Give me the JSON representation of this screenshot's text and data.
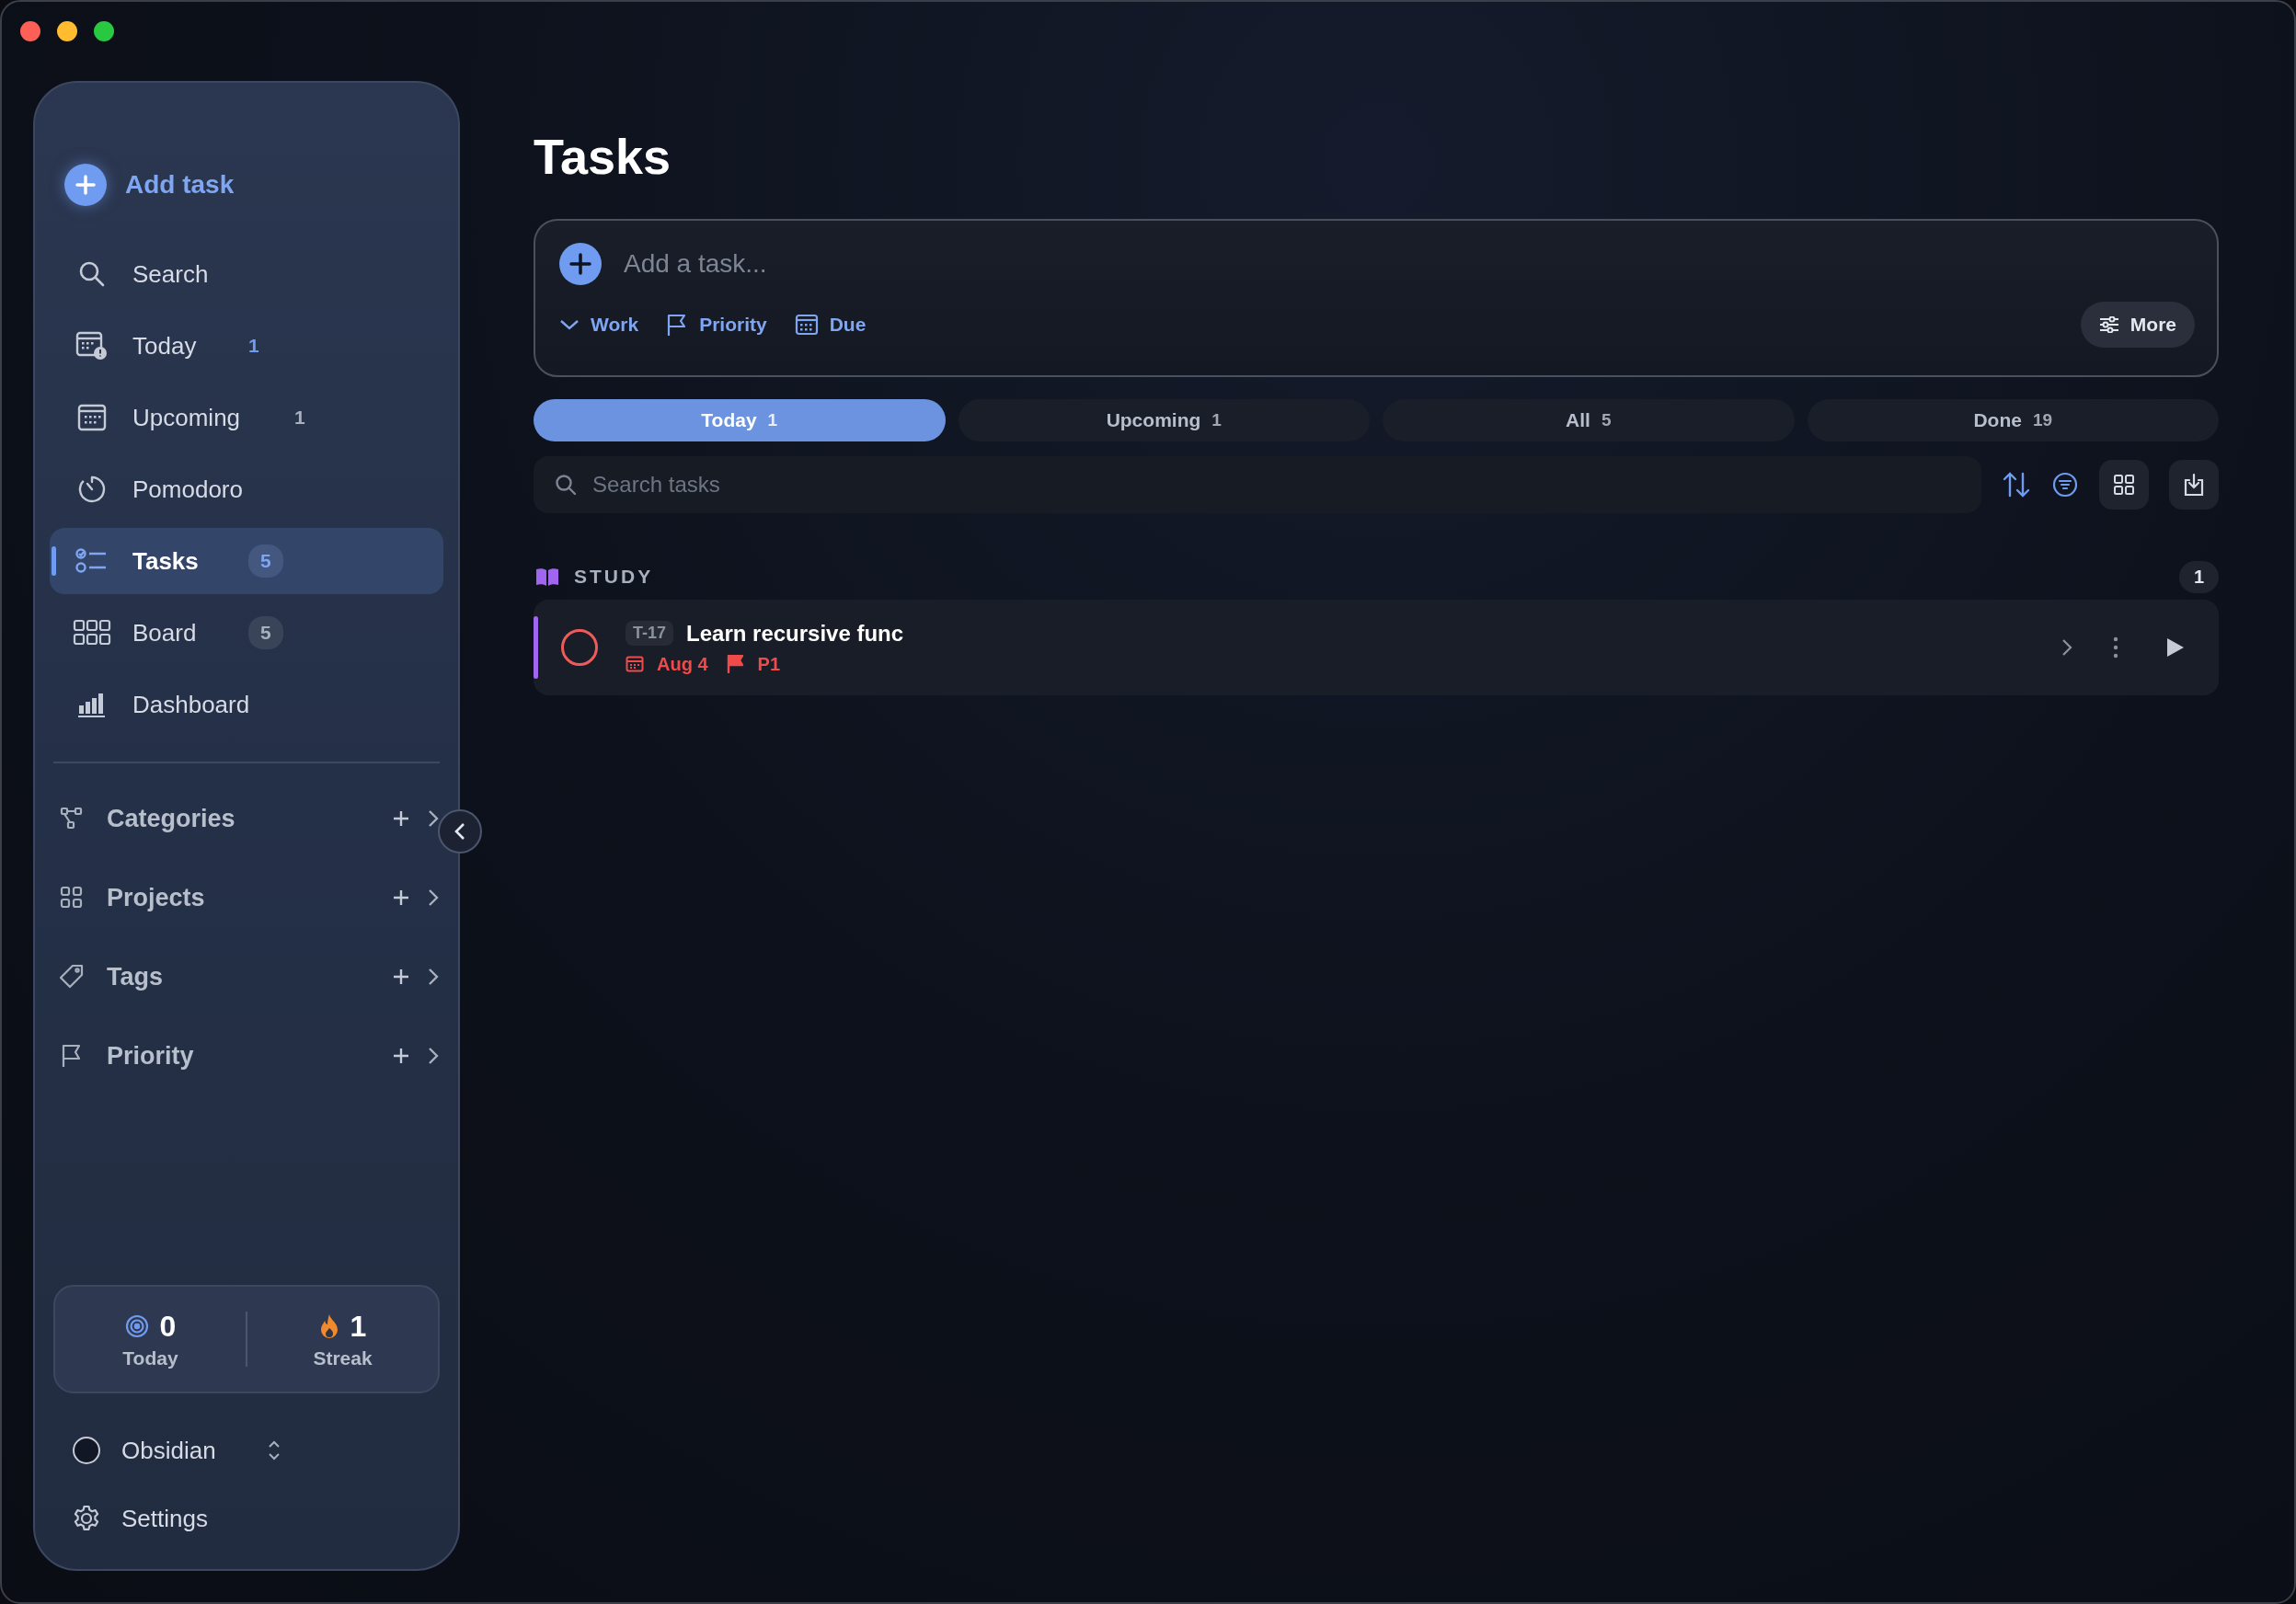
{
  "sidebar": {
    "add_task": "Add task",
    "nav": [
      {
        "kind": "search",
        "label": "Search",
        "selected": false
      },
      {
        "kind": "today",
        "label": "Today",
        "badge": "1",
        "pill": false,
        "accent": true,
        "selected": false
      },
      {
        "kind": "upcoming",
        "label": "Upcoming",
        "badge": "1",
        "pill": false,
        "accent": false,
        "selected": false
      },
      {
        "kind": "pomodoro",
        "label": "Pomodoro",
        "selected": false
      },
      {
        "kind": "tasks",
        "label": "Tasks",
        "badge": "5",
        "pill": true,
        "accent": true,
        "selected": true
      },
      {
        "kind": "board",
        "label": "Board",
        "badge": "5",
        "pill": true,
        "accent": false,
        "selected": false
      },
      {
        "kind": "dashboard",
        "label": "Dashboard",
        "selected": false
      }
    ],
    "sections": [
      {
        "kind": "categories",
        "label": "Categories"
      },
      {
        "kind": "projects",
        "label": "Projects"
      },
      {
        "kind": "tags",
        "label": "Tags"
      },
      {
        "kind": "priority",
        "label": "Priority"
      }
    ],
    "stats": [
      {
        "kind": "target",
        "value": "0",
        "label": "Today"
      },
      {
        "kind": "flame",
        "value": "1",
        "label": "Streak"
      }
    ],
    "theme": "Obsidian",
    "settings": "Settings"
  },
  "main": {
    "title": "Tasks",
    "composer": {
      "placeholder": "Add a task...",
      "chips": [
        {
          "kind": "chevron",
          "label": "Work"
        },
        {
          "kind": "flag",
          "label": "Priority"
        },
        {
          "kind": "calendar",
          "label": "Due"
        }
      ],
      "more": "More"
    },
    "tabs": [
      {
        "label": "Today",
        "count": "1",
        "selected": true
      },
      {
        "label": "Upcoming",
        "count": "1",
        "selected": false
      },
      {
        "label": "All",
        "count": "5",
        "selected": false
      },
      {
        "label": "Done",
        "count": "19",
        "selected": false
      }
    ],
    "search": {
      "placeholder": "Search tasks"
    },
    "groups": [
      {
        "name": "STUDY",
        "count": "1",
        "color": "#a066f0",
        "tasks": [
          {
            "done": false,
            "id": "T-17",
            "title": "Learn recursive func",
            "due": "Aug 4",
            "priority": "P1"
          }
        ]
      }
    ]
  }
}
